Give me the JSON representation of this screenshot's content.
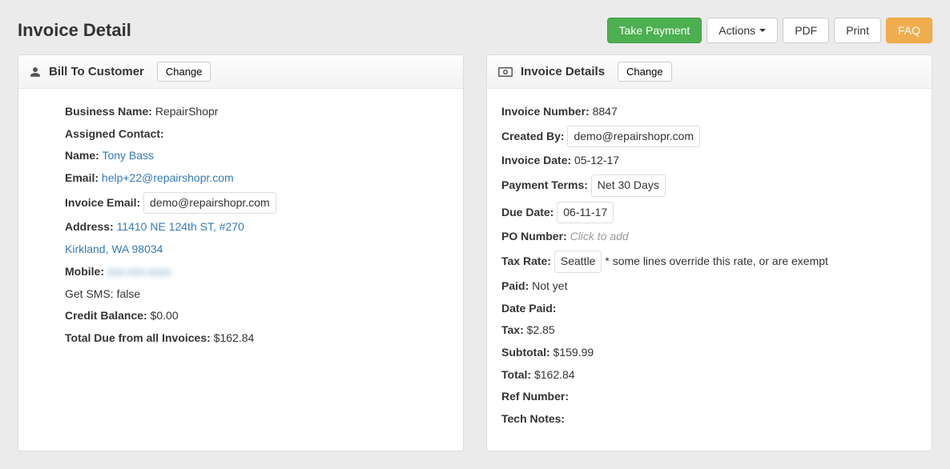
{
  "page_title": "Invoice Detail",
  "toolbar": {
    "take_payment": "Take Payment",
    "actions": "Actions",
    "pdf": "PDF",
    "print": "Print",
    "faq": "FAQ"
  },
  "bill_to": {
    "title": "Bill To Customer",
    "change_label": "Change",
    "business_name_label": "Business Name:",
    "business_name": "RepairShopr",
    "assigned_contact_label": "Assigned Contact:",
    "name_label": "Name:",
    "name": "Tony Bass",
    "email_label": "Email:",
    "email": "help+22@repairshopr.com",
    "invoice_email_label": "Invoice Email:",
    "invoice_email": "demo@repairshopr.com",
    "address_label": "Address:",
    "address_line1": "11410 NE 124th ST, #270",
    "address_line2": "Kirkland, WA 98034",
    "mobile_label": "Mobile:",
    "mobile": "xxx-xxx-xxxx",
    "get_sms_line": "Get SMS: false",
    "credit_balance_label": "Credit Balance:",
    "credit_balance": "$0.00",
    "total_due_label": "Total Due from all Invoices:",
    "total_due": "$162.84"
  },
  "details": {
    "title": "Invoice Details",
    "change_label": "Change",
    "invoice_number_label": "Invoice Number:",
    "invoice_number": "8847",
    "created_by_label": "Created By:",
    "created_by": "demo@repairshopr.com",
    "invoice_date_label": "Invoice Date:",
    "invoice_date": "05-12-17",
    "payment_terms_label": "Payment Terms:",
    "payment_terms": "Net 30 Days",
    "due_date_label": "Due Date:",
    "due_date": "06-11-17",
    "po_number_label": "PO Number:",
    "po_number_placeholder": "Click to add",
    "tax_rate_label": "Tax Rate:",
    "tax_rate": "Seattle",
    "tax_rate_note": "* some lines override this rate, or are exempt",
    "paid_label": "Paid:",
    "paid": "Not yet",
    "date_paid_label": "Date Paid:",
    "date_paid": "",
    "tax_label": "Tax:",
    "tax": "$2.85",
    "subtotal_label": "Subtotal:",
    "subtotal": "$159.99",
    "total_label": "Total:",
    "total": "$162.84",
    "ref_number_label": "Ref Number:",
    "ref_number": "",
    "tech_notes_label": "Tech Notes:",
    "tech_notes": ""
  }
}
